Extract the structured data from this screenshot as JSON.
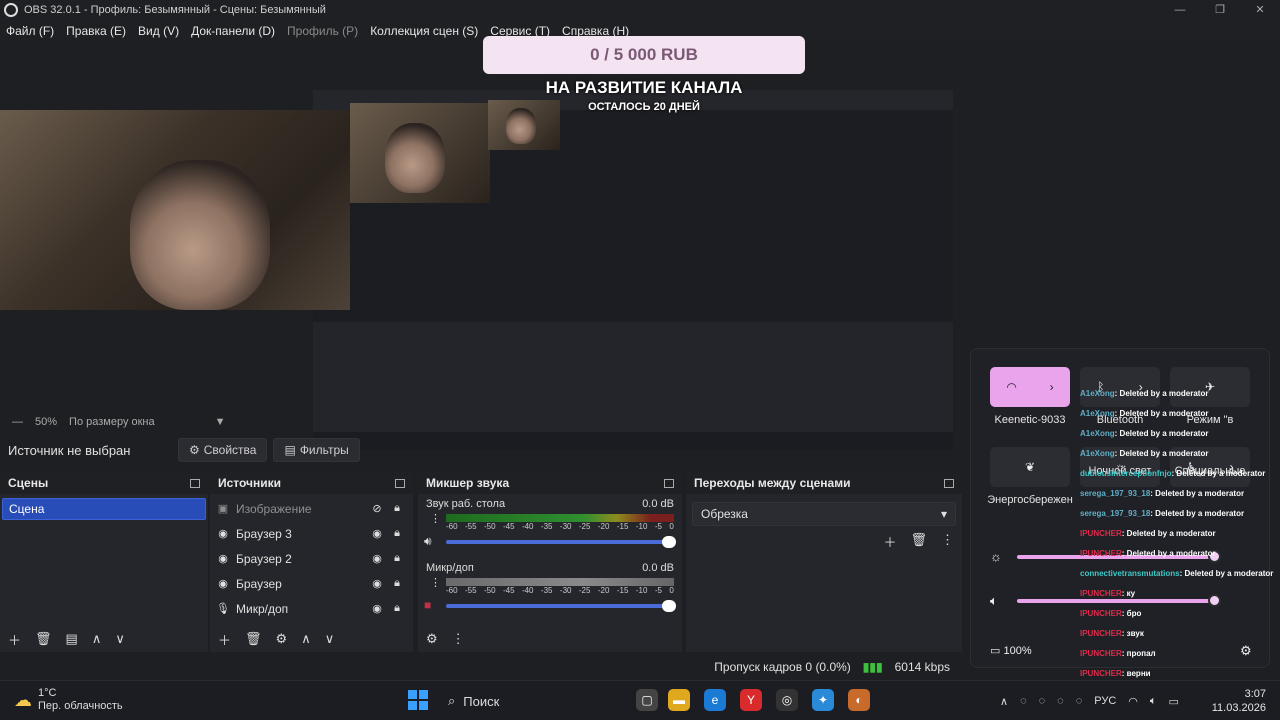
{
  "window": {
    "title": "OBS 32.0.1 - Профиль: Безымянный - Сцены: Безымянный",
    "controls": [
      "—",
      "❐",
      "✕"
    ]
  },
  "menu": [
    {
      "label": "Файл (F)",
      "enabled": true
    },
    {
      "label": "Правка (E)",
      "enabled": true
    },
    {
      "label": "Вид (V)",
      "enabled": true
    },
    {
      "label": "Док-панели (D)",
      "enabled": true
    },
    {
      "label": "Профиль (P)",
      "enabled": false
    },
    {
      "label": "Коллекция сцен (S)",
      "enabled": true
    },
    {
      "label": "Сервис (T)",
      "enabled": true
    },
    {
      "label": "Справка (H)",
      "enabled": true
    }
  ],
  "preview": {
    "donation_amount": "0 / 5 000 RUB",
    "donation_goal": "НА РАЗВИТИЕ КАНАЛА",
    "donation_days": "ОСТАЛОСЬ 20 ДНЕЙ"
  },
  "zoom": {
    "value": "50%",
    "mode": "По размеру окна"
  },
  "source_toolbar": {
    "no_source": "Источник не выбран",
    "properties": "Свойства",
    "filters": "Фильтры"
  },
  "scenes": {
    "title": "Сцены",
    "items": [
      "Сцена"
    ]
  },
  "sources": {
    "title": "Источники",
    "items": [
      {
        "label": "Изображение",
        "icon": "image-icon",
        "dim": true
      },
      {
        "label": "Браузер 3",
        "icon": "globe-icon",
        "dim": false
      },
      {
        "label": "Браузер 2",
        "icon": "globe-icon",
        "dim": false
      },
      {
        "label": "Браузер",
        "icon": "globe-icon",
        "dim": false
      },
      {
        "label": "Микр/доп",
        "icon": "mic-icon",
        "dim": false
      }
    ]
  },
  "mixer": {
    "title": "Микшер звука",
    "channels": [
      {
        "name": "Звук раб. стола",
        "db": "0.0 dB",
        "meter": "color"
      },
      {
        "name": "Микр/доп",
        "db": "0.0 dB",
        "meter": "gray"
      }
    ],
    "scale": [
      "-60",
      "-55",
      "-50",
      "-45",
      "-40",
      "-35",
      "-30",
      "-25",
      "-20",
      "-15",
      "-10",
      "-5",
      "0"
    ]
  },
  "transitions": {
    "title": "Переходы между сценами",
    "selected": "Обрезка"
  },
  "status": {
    "dropped": "Пропуск кадров 0 (0.0%)",
    "bitrate": "6014 kbps"
  },
  "quick_settings": {
    "wifi_label": "Keenetic-9033",
    "bluetooth_label": "Bluetooth",
    "mode_label": "Режим \"в",
    "energy_label": "Энергосбережен",
    "night_label": "Ночной свет",
    "special_label": "Специальные",
    "battery": "100%",
    "accent": "#e9a4ec"
  },
  "chat": [
    {
      "user": "A1eXong",
      "msg": ": Deleted by a moderator",
      "color": "blue"
    },
    {
      "user": "A1eXong",
      "msg": ": Deleted by a moderator",
      "color": "blue"
    },
    {
      "user": "A1eXong",
      "msg": ": Deleted by a moderator",
      "color": "blue"
    },
    {
      "user": "A1eXong",
      "msg": ": Deleted by a moderator",
      "color": "blue"
    },
    {
      "user": "dubiousinterceptionfnjo",
      "msg": ": Deleted by a moderator",
      "color": "teal"
    },
    {
      "user": "serega_197_93_18",
      "msg": ": Deleted by a moderator",
      "color": "blue"
    },
    {
      "user": "serega_197_93_18",
      "msg": ": Deleted by a moderator",
      "color": "blue"
    },
    {
      "user": "IPUNCHER",
      "msg": ": Deleted by a moderator",
      "color": "red"
    },
    {
      "user": "IPUNCHER",
      "msg": ": Deleted by a moderator",
      "color": "red"
    },
    {
      "user": "connectivetransmutations",
      "msg": ": Deleted by a moderator",
      "color": "teal"
    },
    {
      "user": "IPUNCHER",
      "msg": ": ку",
      "color": "red"
    },
    {
      "user": "IPUNCHER",
      "msg": ": бро",
      "color": "red"
    },
    {
      "user": "IPUNCHER",
      "msg": ": звук",
      "color": "red"
    },
    {
      "user": "IPUNCHER",
      "msg": ": пропал",
      "color": "red"
    },
    {
      "user": "IPUNCHER",
      "msg": ": верни",
      "color": "red"
    }
  ],
  "taskbar": {
    "temp": "1°C",
    "weather": "Пер. облачность",
    "search": "Поиск",
    "lang": "РУС",
    "time": "3:07",
    "date": "11.03.2026"
  }
}
